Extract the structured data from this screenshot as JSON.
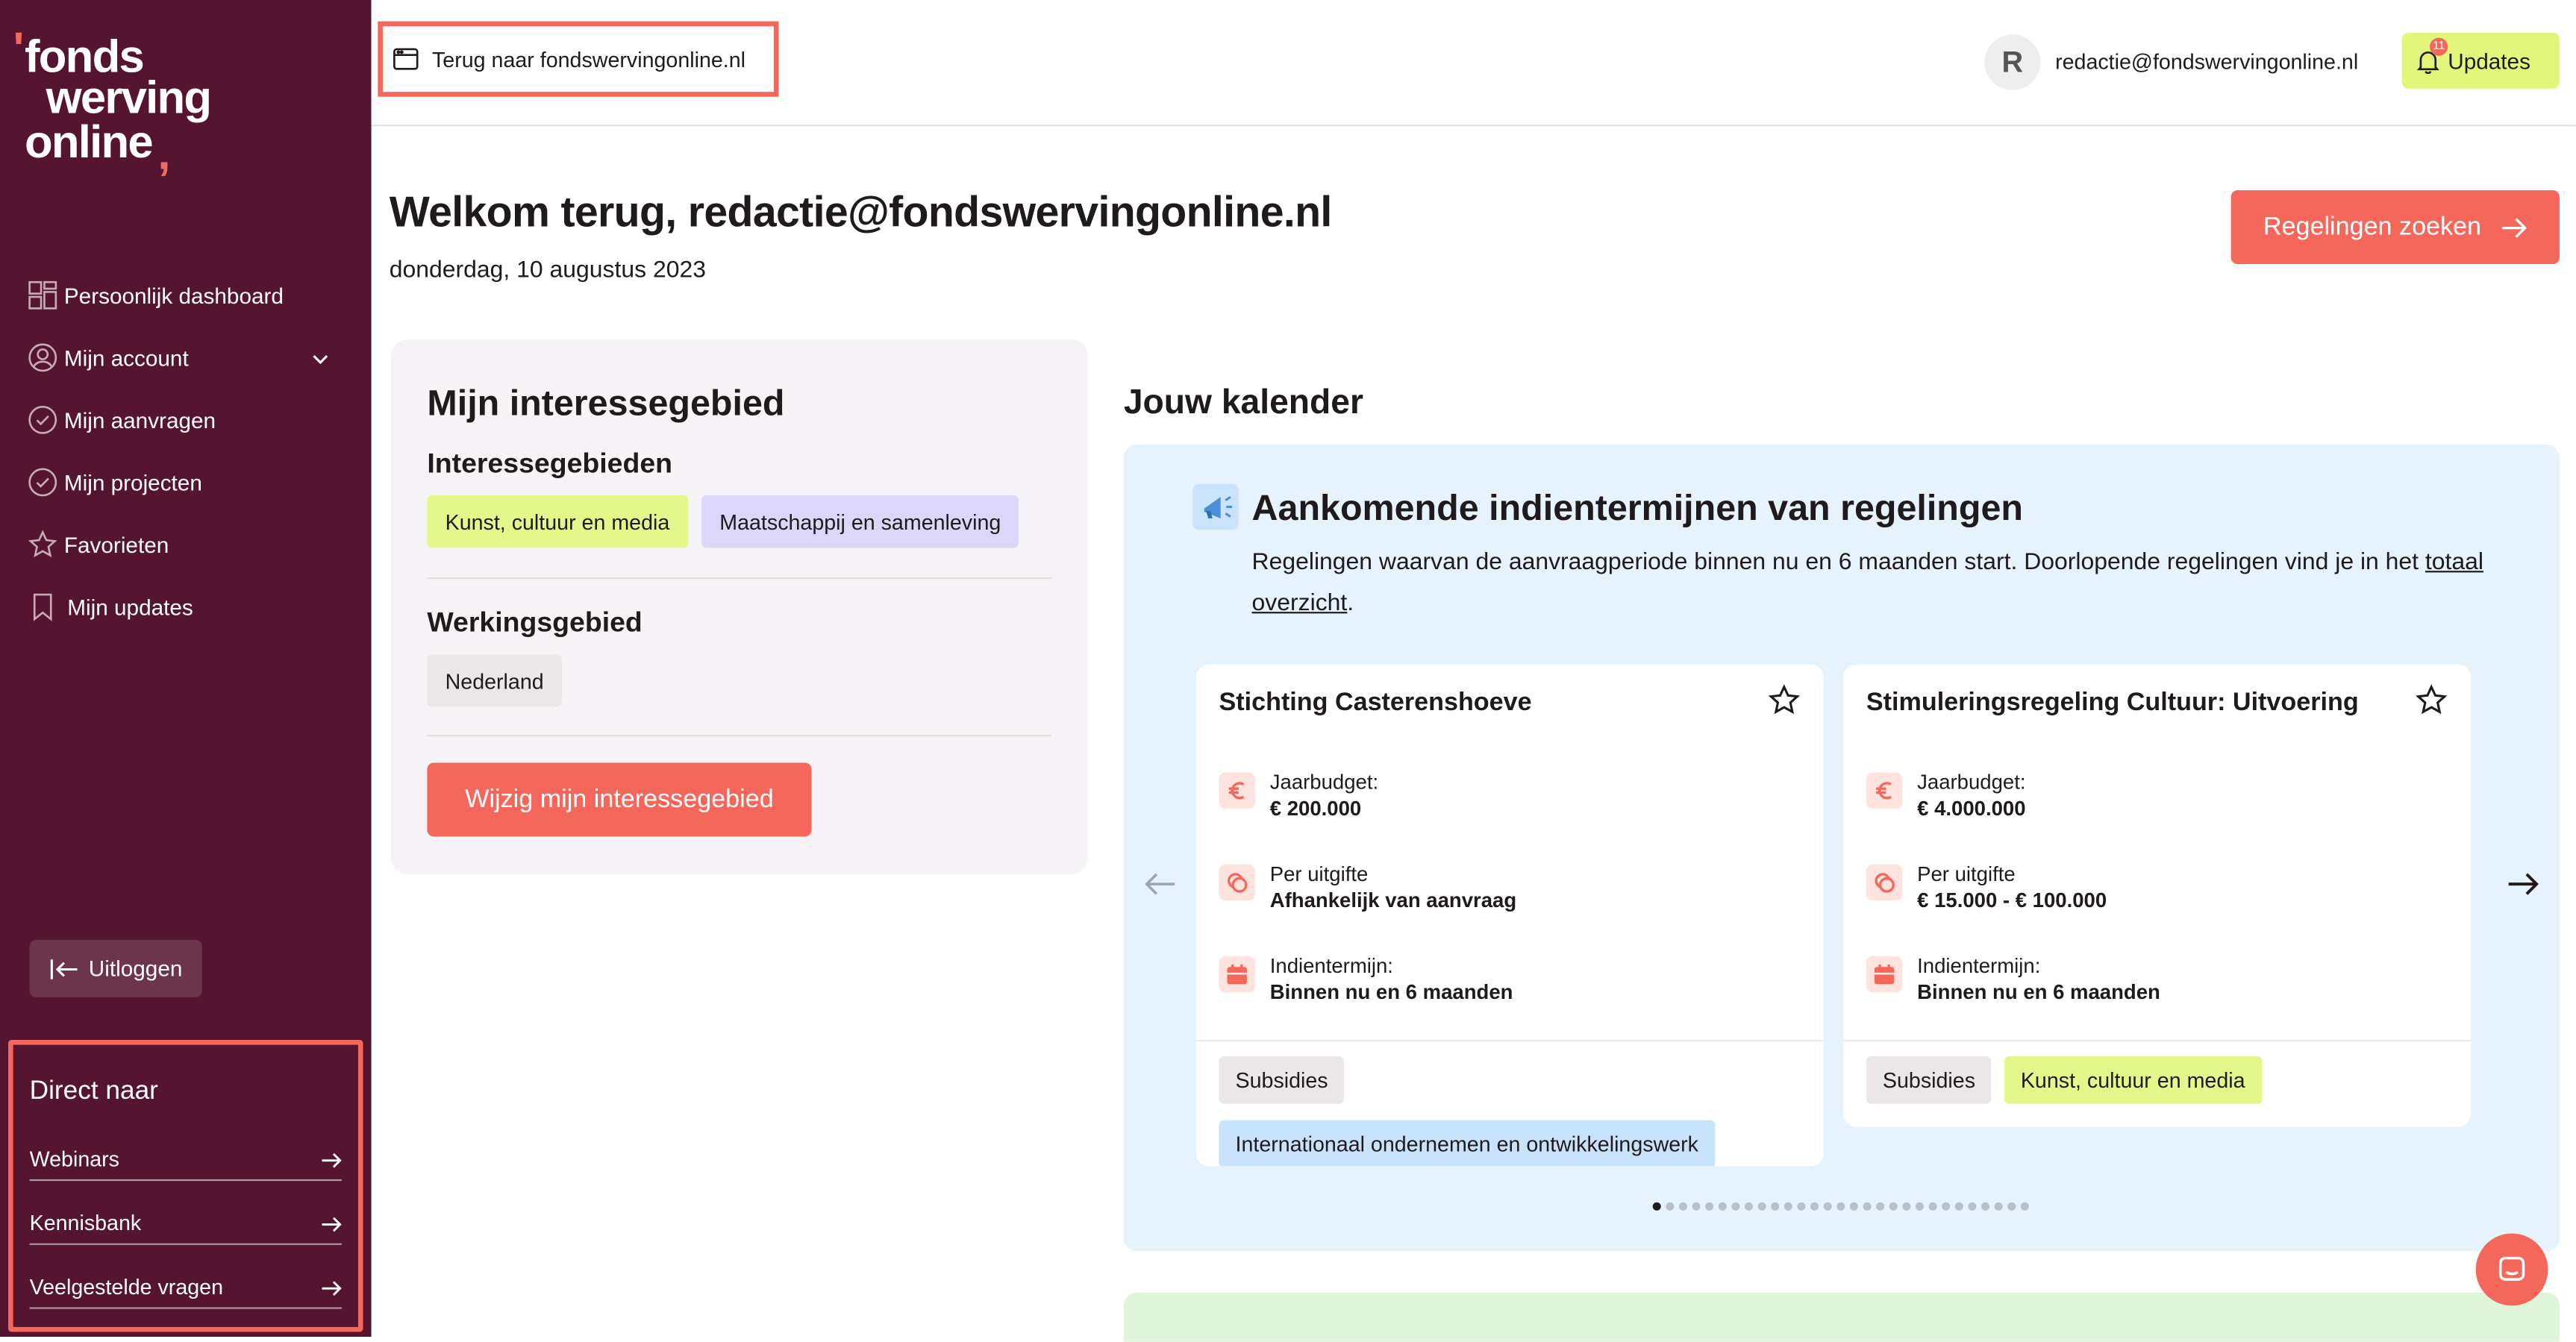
{
  "logo": {
    "line1": "fonds",
    "line2": "werving",
    "line3": "online"
  },
  "sidebar": {
    "items": [
      {
        "label": "Persoonlijk dashboard",
        "icon": "dashboard-grid-icon"
      },
      {
        "label": "Mijn account",
        "icon": "user-circle-icon"
      },
      {
        "label": "Mijn aanvragen",
        "icon": "check-circle-icon"
      },
      {
        "label": "Mijn projecten",
        "icon": "check-circle-icon"
      },
      {
        "label": "Favorieten",
        "icon": "star-icon"
      },
      {
        "label": "Mijn updates",
        "icon": "bookmark-icon"
      }
    ],
    "logout_label": "Uitloggen",
    "direct": {
      "title": "Direct naar",
      "links": [
        "Webinars",
        "Kennisbank",
        "Veelgestelde vragen"
      ]
    }
  },
  "topbar": {
    "back_label": "Terug naar fondswervingonline.nl",
    "avatar_initial": "R",
    "user_email": "redactie@fondswervingonline.nl",
    "updates_label": "Updates",
    "updates_count": "11"
  },
  "main": {
    "welcome": "Welkom terug, redactie@fondswervingonline.nl",
    "date": "donderdag, 10 augustus 2023",
    "search_button": "Regelingen zoeken"
  },
  "interest": {
    "title": "Mijn interessegebied",
    "areas_title": "Interessegebieden",
    "areas": [
      "Kunst, cultuur en media",
      "Maatschappij en samenleving"
    ],
    "region_title": "Werkingsgebied",
    "region": "Nederland",
    "change_button": "Wijzig mijn interessegebied"
  },
  "calendar": {
    "title": "Jouw kalender",
    "heading": "Aankomende indientermijnen van regelingen",
    "description": "Regelingen waarvan de aanvraagperiode binnen nu en 6 maanden start. Doorlopende regelingen vind je in het",
    "link": "totaal overzicht",
    "description_end": ".",
    "cards": [
      {
        "title": "Stichting Casterenshoeve",
        "budget_label": "Jaarbudget:",
        "budget_value": "€ 200.000",
        "per_label": "Per uitgifte",
        "per_value": "Afhankelijk van aanvraag",
        "term_label": "Indientermijn:",
        "term_value": "Binnen nu en 6 maanden",
        "tags": [
          "Subsidies",
          "Internationaal ondernemen en ontwikkelingswerk"
        ]
      },
      {
        "title": "Stimuleringsregeling Cultuur: Uitvoering",
        "budget_label": "Jaarbudget:",
        "budget_value": "€ 4.000.000",
        "per_label": "Per uitgifte",
        "per_value": "€ 15.000 - € 100.000",
        "term_label": "Indientermijn:",
        "term_value": "Binnen nu en 6 maanden",
        "tags": [
          "Subsidies",
          "Kunst, cultuur en media"
        ]
      }
    ],
    "active_slide": 1,
    "slide_count": 29
  },
  "colors": {
    "sidebar": "#55142f",
    "accent": "#f4675a",
    "highlight": "#e2f67a",
    "calendar_bg": "#e6f2fc"
  }
}
